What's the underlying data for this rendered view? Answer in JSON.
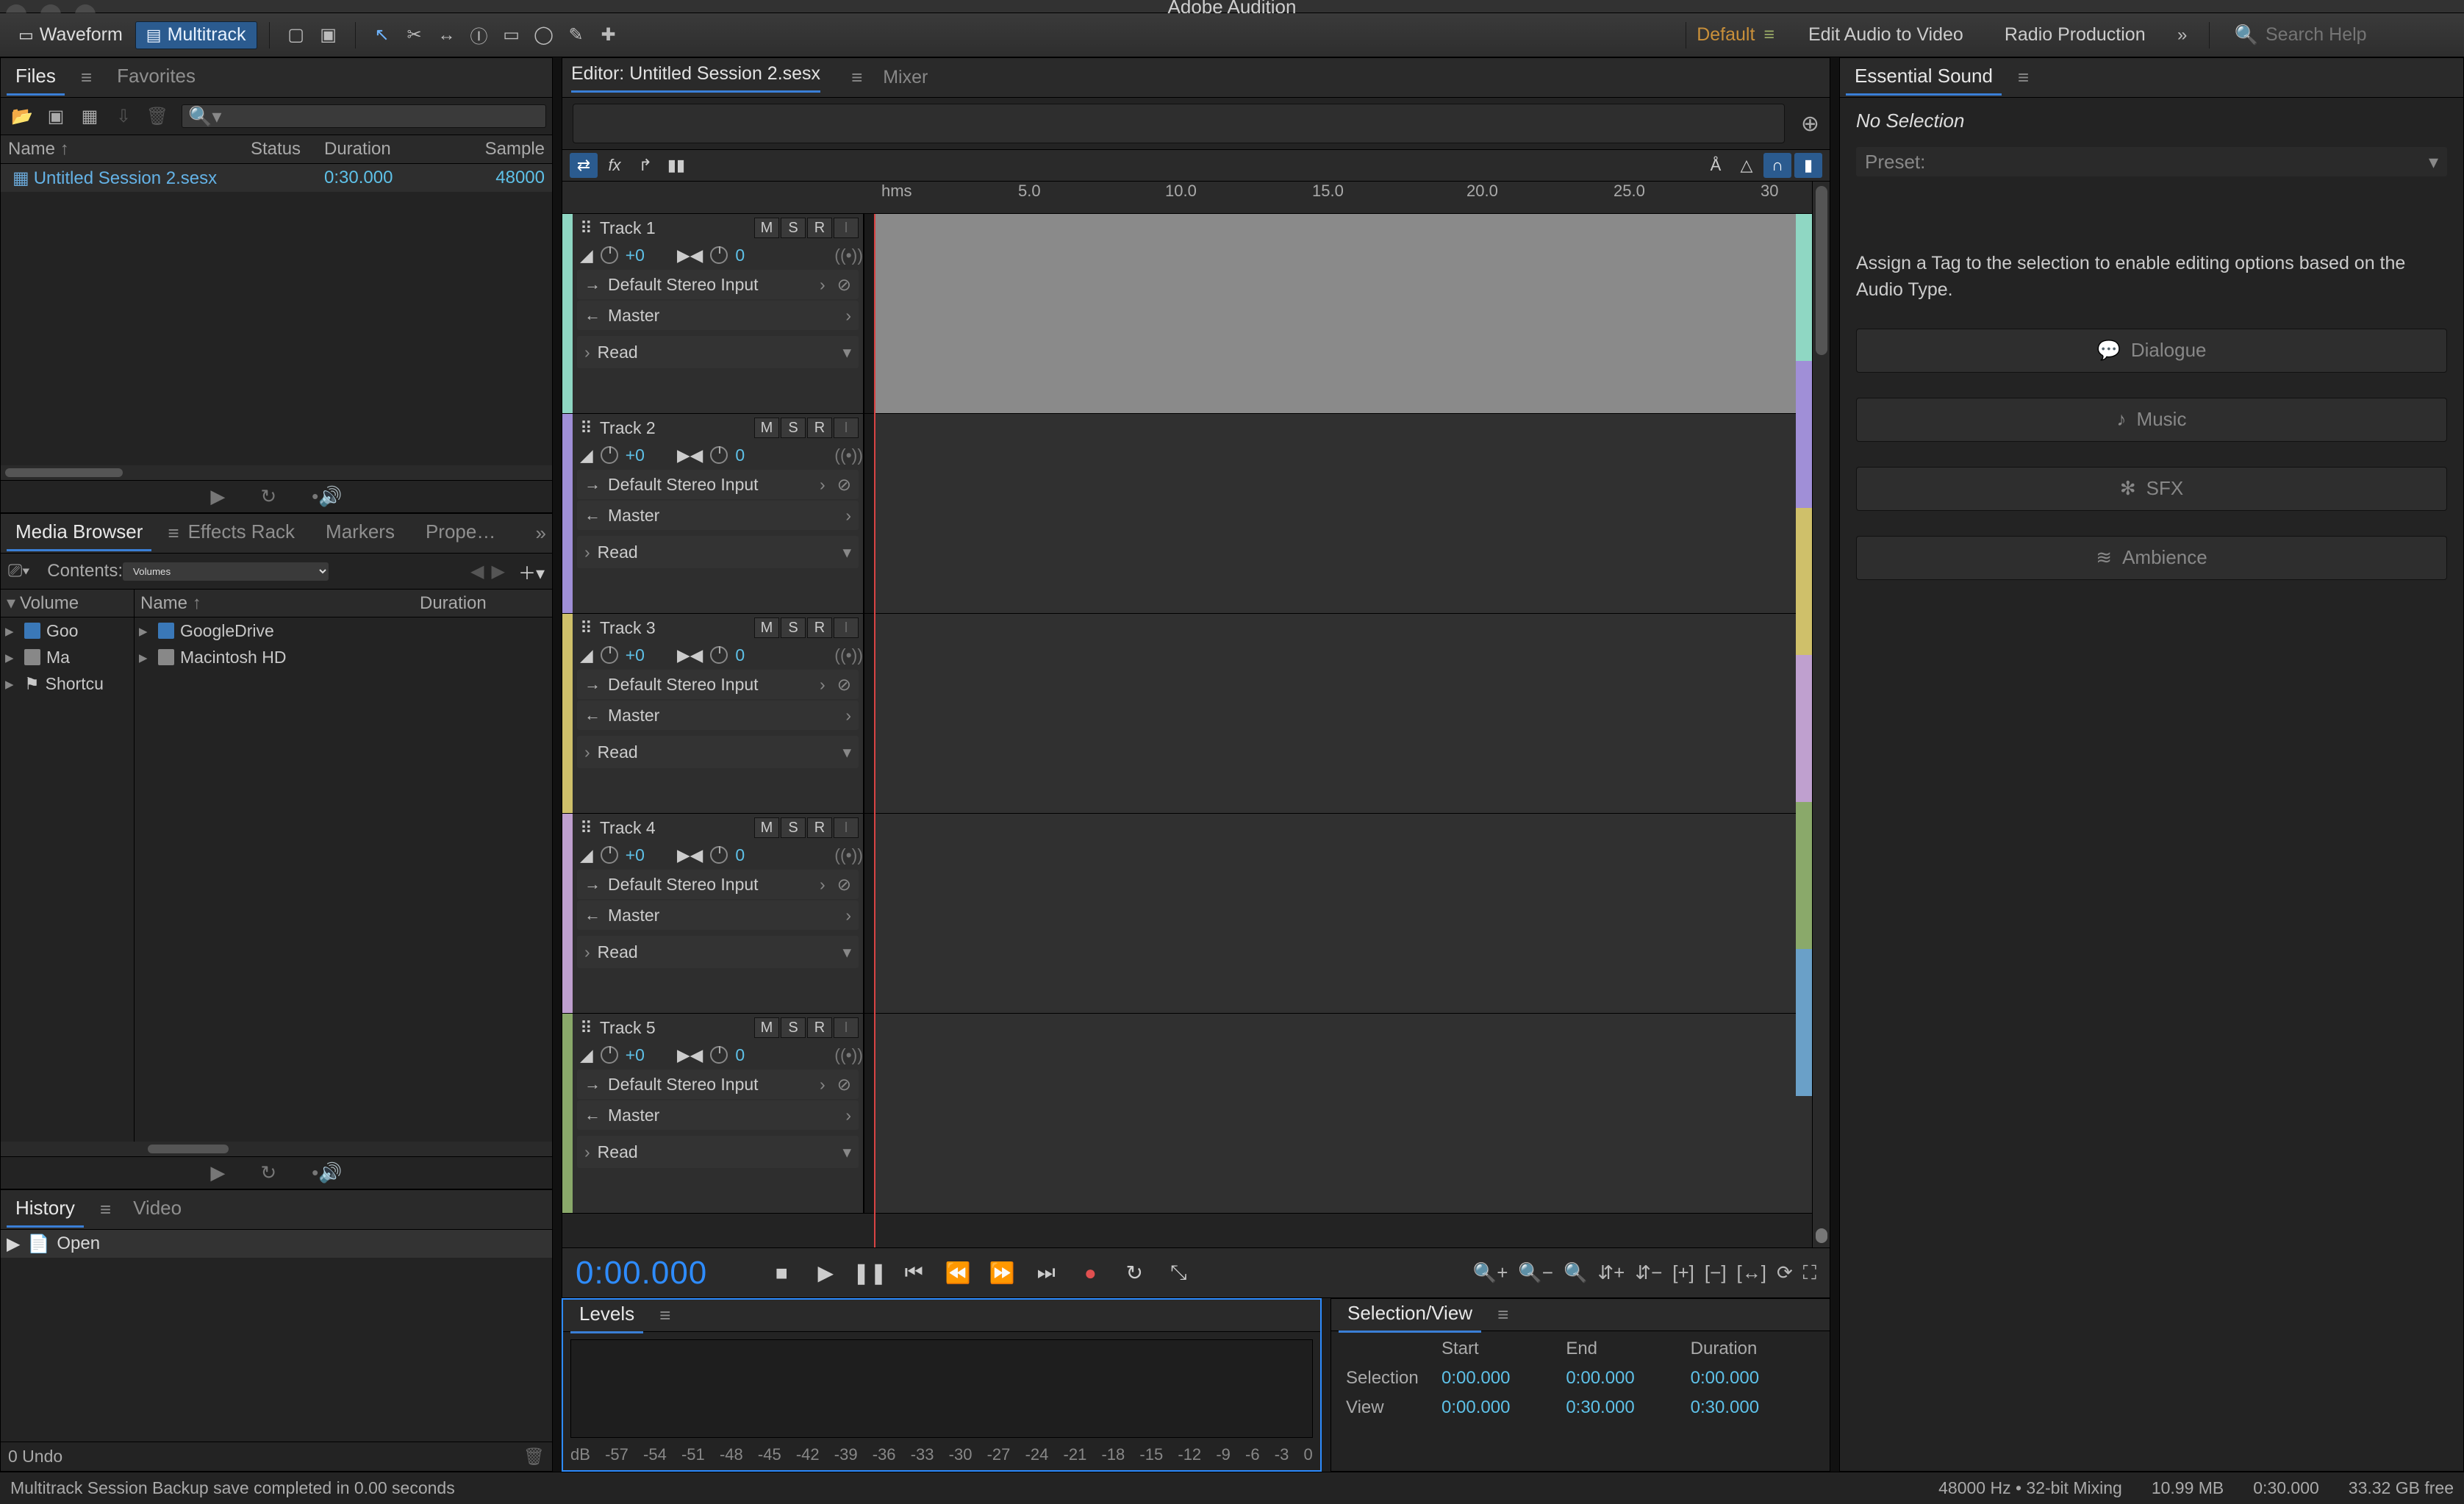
{
  "app_title": "Adobe Audition",
  "toolbar": {
    "waveform": "Waveform",
    "multitrack": "Multitrack",
    "workspace_default": "Default",
    "ws_links": [
      "Edit Audio to Video",
      "Radio Production"
    ],
    "search_placeholder": "Search Help"
  },
  "files_panel": {
    "tabs": [
      "Files",
      "Favorites"
    ],
    "cols": {
      "name": "Name",
      "status": "Status",
      "duration": "Duration",
      "sample": "Sample"
    },
    "row": {
      "name": "Untitled Session 2.sesx",
      "duration": "0:30.000",
      "sample": "48000"
    }
  },
  "media_browser": {
    "tabs": [
      "Media Browser",
      "Effects Rack",
      "Markers",
      "Prope…"
    ],
    "contents_label": "Contents:",
    "contents_value": "Volumes",
    "left_header": "Volume",
    "right_name": "Name",
    "right_dur": "Duration",
    "left_rows": [
      "Goo",
      "Ma",
      "Shortcu"
    ],
    "right_rows": [
      "GoogleDrive",
      "Macintosh HD"
    ]
  },
  "history": {
    "tabs": [
      "History",
      "Video"
    ],
    "row": "Open",
    "undo": "0 Undo"
  },
  "editor": {
    "tabs": {
      "editor_prefix": "Editor: ",
      "file": "Untitled Session 2.sesx",
      "mixer": "Mixer"
    },
    "ruler": {
      "unit": "hms",
      "ticks": [
        "5.0",
        "10.0",
        "15.0",
        "20.0",
        "25.0",
        "30"
      ]
    },
    "tracks": [
      {
        "name": "Track 1",
        "vol": "+0",
        "pan": "0",
        "input": "Default Stereo Input",
        "output": "Master",
        "automation": "Read",
        "color": "#8fd7c3"
      },
      {
        "name": "Track 2",
        "vol": "+0",
        "pan": "0",
        "input": "Default Stereo Input",
        "output": "Master",
        "automation": "Read",
        "color": "#a08fd7"
      },
      {
        "name": "Track 3",
        "vol": "+0",
        "pan": "0",
        "input": "Default Stereo Input",
        "output": "Master",
        "automation": "Read",
        "color": "#cfc06a"
      },
      {
        "name": "Track 4",
        "vol": "+0",
        "pan": "0",
        "input": "Default Stereo Input",
        "output": "Master",
        "automation": "Read",
        "color": "#bfa0cf"
      },
      {
        "name": "Track 5",
        "vol": "+0",
        "pan": "0",
        "input": "Default Stereo Input",
        "output": "Master",
        "automation": "Read",
        "color": "#8aa96a"
      }
    ],
    "msr": {
      "m": "M",
      "s": "S",
      "r": "R",
      "i": "I"
    },
    "timecode": "0:00.000"
  },
  "levels": {
    "title": "Levels",
    "scale": [
      "dB",
      "-57",
      "-54",
      "-51",
      "-48",
      "-45",
      "-42",
      "-39",
      "-36",
      "-33",
      "-30",
      "-27",
      "-24",
      "-21",
      "-18",
      "-15",
      "-12",
      "-9",
      "-6",
      "-3",
      "0"
    ]
  },
  "selection_view": {
    "title": "Selection/View",
    "cols": {
      "start": "Start",
      "end": "End",
      "duration": "Duration"
    },
    "selection": {
      "label": "Selection",
      "start": "0:00.000",
      "end": "0:00.000",
      "dur": "0:00.000"
    },
    "view": {
      "label": "View",
      "start": "0:00.000",
      "end": "0:30.000",
      "dur": "0:30.000"
    }
  },
  "essential_sound": {
    "title": "Essential Sound",
    "no_selection": "No Selection",
    "preset_label": "Preset:",
    "hint": "Assign a Tag to the selection to enable editing options based on the Audio Type.",
    "buttons": [
      "Dialogue",
      "Music",
      "SFX",
      "Ambience"
    ]
  },
  "status": {
    "msg": "Multitrack Session Backup save completed in 0.00 seconds",
    "right": [
      "48000 Hz • 32-bit Mixing",
      "10.99 MB",
      "0:30.000",
      "33.32 GB free"
    ]
  }
}
